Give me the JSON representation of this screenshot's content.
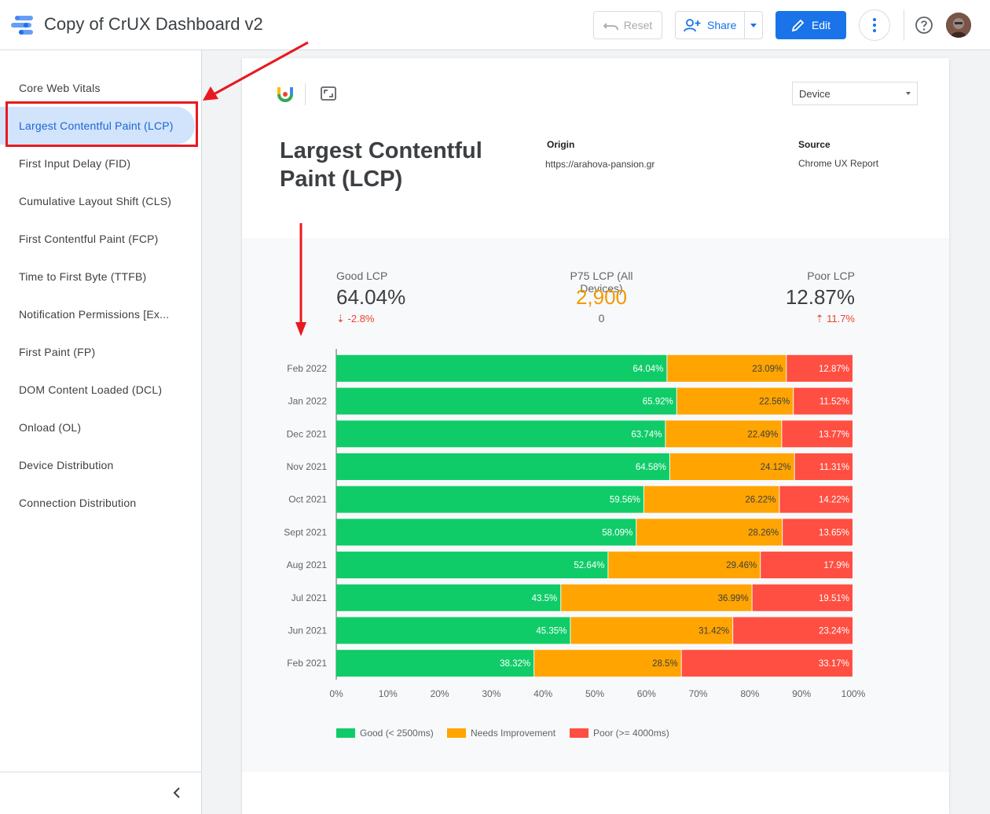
{
  "app": {
    "title": "Copy of CrUX Dashboard v2"
  },
  "toolbar": {
    "reset_label": "Reset",
    "share_label": "Share",
    "edit_label": "Edit"
  },
  "sidebar": {
    "items": [
      {
        "label": "Core Web Vitals"
      },
      {
        "label": "Largest Contentful Paint (LCP)"
      },
      {
        "label": "First Input Delay (FID)"
      },
      {
        "label": "Cumulative Layout Shift (CLS)"
      },
      {
        "label": "First Contentful Paint (FCP)"
      },
      {
        "label": "Time to First Byte (TTFB)"
      },
      {
        "label": "Notification Permissions [Ex..."
      },
      {
        "label": "First Paint (FP)"
      },
      {
        "label": "DOM Content Loaded (DCL)"
      },
      {
        "label": "Onload (OL)"
      },
      {
        "label": "Device Distribution"
      },
      {
        "label": "Connection Distribution"
      }
    ],
    "active_index": 1
  },
  "report": {
    "device_select": "Device",
    "title": "Largest Contentful Paint (LCP)",
    "origin_label": "Origin",
    "origin_value": "https://arahova-pansion.gr",
    "source_label": "Source",
    "source_value": "Chrome UX Report"
  },
  "kpis": {
    "good": {
      "label": "Good LCP",
      "value": "64.04%",
      "change": "-2.8%"
    },
    "p75": {
      "label": "P75 LCP (All Devices)",
      "value": "2,900",
      "sub": "0"
    },
    "poor": {
      "label": "Poor LCP",
      "value": "12.87%",
      "change": "11.7%"
    }
  },
  "colors": {
    "good": "#0fcc68",
    "needs": "#ffa400",
    "poor": "#ff4e42",
    "accent": "#1a73e8",
    "p75": "#f29900"
  },
  "chart_data": {
    "type": "bar",
    "orientation": "horizontal",
    "stacked": true,
    "categories": [
      "Feb 2022",
      "Jan 2022",
      "Dec 2021",
      "Nov 2021",
      "Oct 2021",
      "Sept 2021",
      "Aug 2021",
      "Jul 2021",
      "Jun 2021",
      "Feb 2021"
    ],
    "series": [
      {
        "name": "Good (< 2500ms)",
        "values": [
          64.04,
          65.92,
          63.74,
          64.58,
          59.56,
          58.09,
          52.64,
          43.5,
          45.35,
          38.32
        ],
        "labels": [
          "64.04%",
          "65.92%",
          "63.74%",
          "64.58%",
          "59.56%",
          "58.09%",
          "52.64%",
          "43.5%",
          "45.35%",
          "38.32%"
        ]
      },
      {
        "name": "Needs Improvement",
        "values": [
          23.09,
          22.56,
          22.49,
          24.12,
          26.22,
          28.26,
          29.46,
          36.99,
          31.42,
          28.5
        ],
        "labels": [
          "23.09%",
          "22.56%",
          "22.49%",
          "24.12%",
          "26.22%",
          "28.26%",
          "29.46%",
          "36.99%",
          "31.42%",
          "28.5%"
        ]
      },
      {
        "name": "Poor (>= 4000ms)",
        "values": [
          12.87,
          11.52,
          13.77,
          11.31,
          14.22,
          13.65,
          17.9,
          19.51,
          23.24,
          33.17
        ],
        "labels": [
          "12.87%",
          "11.52%",
          "13.77%",
          "11.31%",
          "14.22%",
          "13.65%",
          "17.9%",
          "19.51%",
          "23.24%",
          "33.17%"
        ]
      }
    ],
    "xticks": [
      "0%",
      "10%",
      "20%",
      "30%",
      "40%",
      "50%",
      "60%",
      "70%",
      "80%",
      "90%",
      "100%"
    ],
    "xlim": [
      0,
      100
    ],
    "legend": "bottom-left"
  }
}
